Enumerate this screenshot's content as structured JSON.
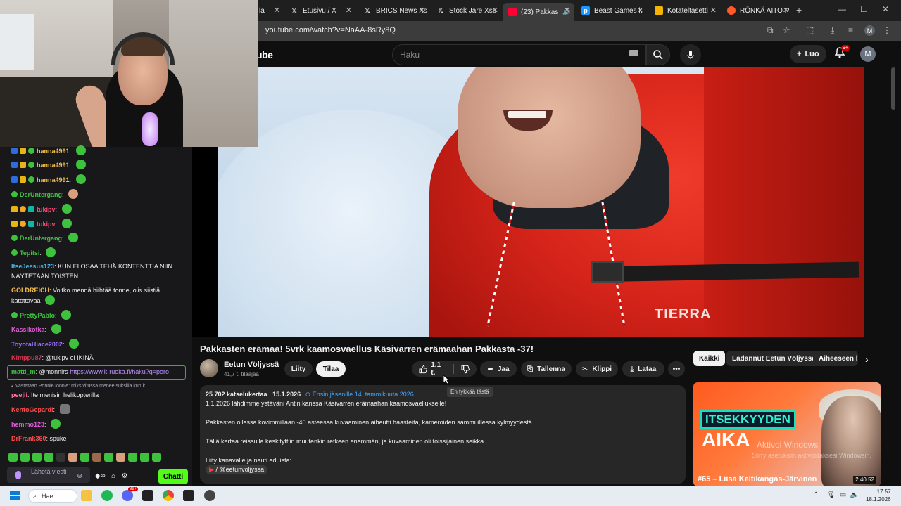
{
  "browser": {
    "tabs": [
      {
        "label": "la",
        "icon": "youtube-icon"
      },
      {
        "label": "Etusivu / X",
        "icon": "x-icon"
      },
      {
        "label": "BRICS News Xs",
        "icon": "x-icon"
      },
      {
        "label": "Stock Jare Xss",
        "icon": "x-icon"
      },
      {
        "label": "(23) Pakkas",
        "icon": "youtube-icon"
      },
      {
        "label": "Beast Games k",
        "icon": "prime-icon"
      },
      {
        "label": "Kotateltasetti",
        "icon": "bookmark-icon"
      },
      {
        "label": "RÖNKÄ AITO P",
        "icon": "shop-icon"
      }
    ],
    "url": "youtube.com/watch?v=NaAA-8sRy8Q",
    "profile_initial": "M"
  },
  "youtube": {
    "logo_text": "ube",
    "search_placeholder": "Haku",
    "create_label": "Luo",
    "notifications_badge": "9+",
    "user_initial": "M",
    "video": {
      "title": "Pakkasten erämaa! 5vrk kaamosvaellus Käsivarren erämaahan Pakkasta -37!",
      "watermark": "TIERRA",
      "channel": "Eetun Völjyssä",
      "subscribers": "41,7 t. tilaajaa",
      "join_label": "Liity",
      "subscribe_label": "Tilaa",
      "likes": "1,1 t.",
      "share_label": "Jaa",
      "save_label": "Tallenna",
      "clip_label": "Klippi",
      "download_label": "Lataa",
      "tooltip": "En tykkää tästä",
      "description": {
        "views": "25 702 katselukertaa",
        "date": "15.1.2026",
        "first_for_members": "Ensin jäsenille 14. tammikuuta 2026",
        "lines": [
          "1.1.2026 lähdimme ystäväni Antin kanssa Käsivarren erämaahan kaamosvaellukselle!",
          "Pakkasten ollessa kovimmillaan -40 asteessa kuvaaminen aiheutti haasteita, kameroiden sammuillessa kylmyydestä.",
          "Tällä kertaa reissulla keskityttiin muutenkin retkeen enemmän, ja kuvaaminen oli toissijainen seikka.",
          "Liity kanavalle ja nauti eduista:"
        ],
        "handle": "/ @eetunvoljyssa"
      }
    },
    "chips": [
      "Kaikki",
      "Ladannut Eetun Völjyssä",
      "Aiheeseen li"
    ],
    "recommended": {
      "title_line1": "ITSEKKYYDEN",
      "title_line2": "AIKA",
      "episode": "#65 – Liisa Keltikangas-Järvinen",
      "duration": "2.40.52"
    },
    "windows_watermark": "Aktivoi Windows",
    "windows_watermark_sub": "Siirry asetuksiin aktivoidaksesi Windowsin."
  },
  "chat": {
    "messages": [
      {
        "user": "hanna4991",
        "color": "#3ec23e",
        "text": ""
      },
      {
        "user": "hanna4991",
        "color": "#3ec23e",
        "text": ""
      },
      {
        "user": "hanna4991",
        "color": "#3ec23e",
        "text": ""
      },
      {
        "user": "DerUntergang",
        "color": "#3ec23e",
        "text": ""
      },
      {
        "user": "tukipv",
        "color": "#ff4a7a",
        "text": ""
      },
      {
        "user": "tukipv",
        "color": "#ff4a7a",
        "text": ""
      },
      {
        "user": "DerUntergang",
        "color": "#3ec23e",
        "text": ""
      },
      {
        "user": "Tepitsi",
        "color": "#3ec23e",
        "text": ""
      },
      {
        "user": "ItseJeesus123",
        "color": "#47b8e6",
        "text": "KUN EI OSAA TEHÄ KONTENTTIA NIIN NÄYTETÄÄN TOISTEN"
      },
      {
        "user": "GOLDREICH",
        "color": "#f5c14a",
        "text": "Voitko mennä hiihtää tonne, olis siistiä katottavaa"
      },
      {
        "user": "PrettyPablo",
        "color": "#3ec23e",
        "text": ""
      },
      {
        "user": "Kassikotka",
        "color": "#e05ad6",
        "text": ""
      },
      {
        "user": "ToyotaHiace2002",
        "color": "#9a6cff",
        "text": ""
      },
      {
        "user": "Kimppu87",
        "color": "#e0334a",
        "text": "@tukipv ei IKINÄ"
      }
    ],
    "highlight": {
      "user": "matti_m",
      "text": "@monnirs",
      "link": "https://www.k-ruoka.fi/haku?q=poro"
    },
    "reply_note": "Vastataan PonnieJonnie: miks vitussa menee suksilla kun k...",
    "after": [
      {
        "user": "peejii",
        "color": "#ff6fa0",
        "text": "Ite menisin helikopterilla"
      },
      {
        "user": "KentoGepardi",
        "color": "#ff4a4a",
        "text": ""
      },
      {
        "user": "hemmo123",
        "color": "#e05ad6",
        "text": ""
      },
      {
        "user": "DrFrank360",
        "color": "#ff4a4a",
        "text": "spuke"
      }
    ],
    "input_placeholder": "Lähetä viesti",
    "send_label": "Chatti"
  },
  "taskbar": {
    "search_label": "Hae",
    "time": "17.57",
    "date": "18.1.2026",
    "discord_badge": "99+"
  }
}
